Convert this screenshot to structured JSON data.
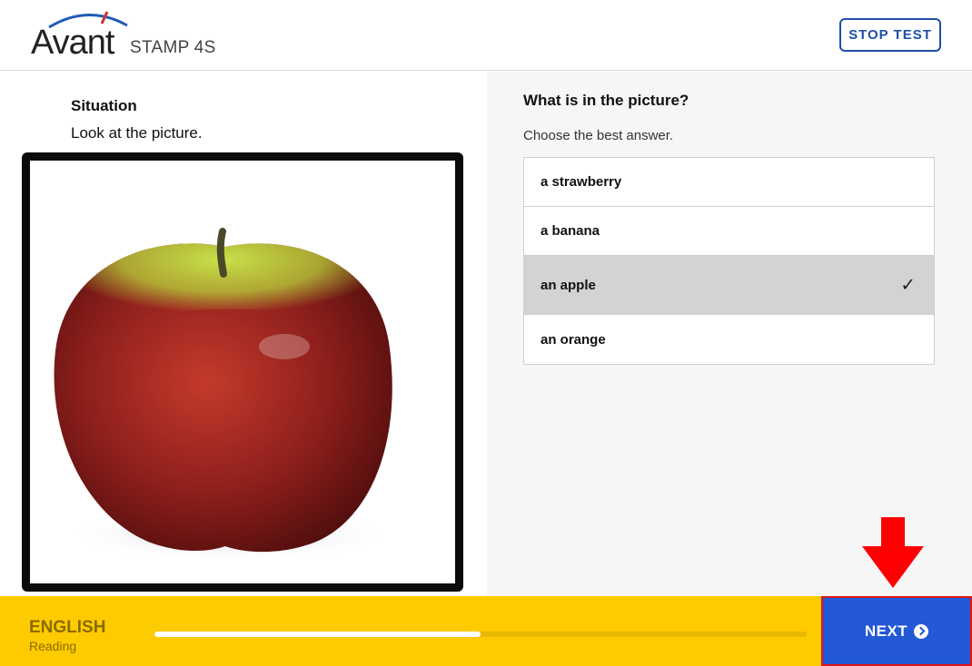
{
  "header": {
    "logo_text": "Avant",
    "product_name": "STAMP 4S",
    "stop_button_label": "STOP TEST"
  },
  "situation": {
    "title": "Situation",
    "text": "Look at the picture.",
    "image_subject": "red and green apple"
  },
  "question": {
    "prompt": "What is in the picture?",
    "instruction": "Choose the best answer.",
    "options": [
      {
        "label": "a strawberry",
        "selected": false
      },
      {
        "label": "a banana",
        "selected": false
      },
      {
        "label": "an apple",
        "selected": true
      },
      {
        "label": "an orange",
        "selected": false
      }
    ]
  },
  "footer": {
    "language": "ENGLISH",
    "skill": "Reading",
    "progress_percent": 50,
    "next_button_label": "NEXT"
  },
  "colors": {
    "footer_bg": "#fecb00",
    "next_button_bg": "#2358d6",
    "accent_blue": "#1f4fa8",
    "annotation_red": "#e0141a",
    "selected_option_bg": "#d3d3d3"
  },
  "icons": {
    "check": "checkmark-icon",
    "next": "circle-chevron-right-icon",
    "annotation": "down-arrow-icon"
  }
}
